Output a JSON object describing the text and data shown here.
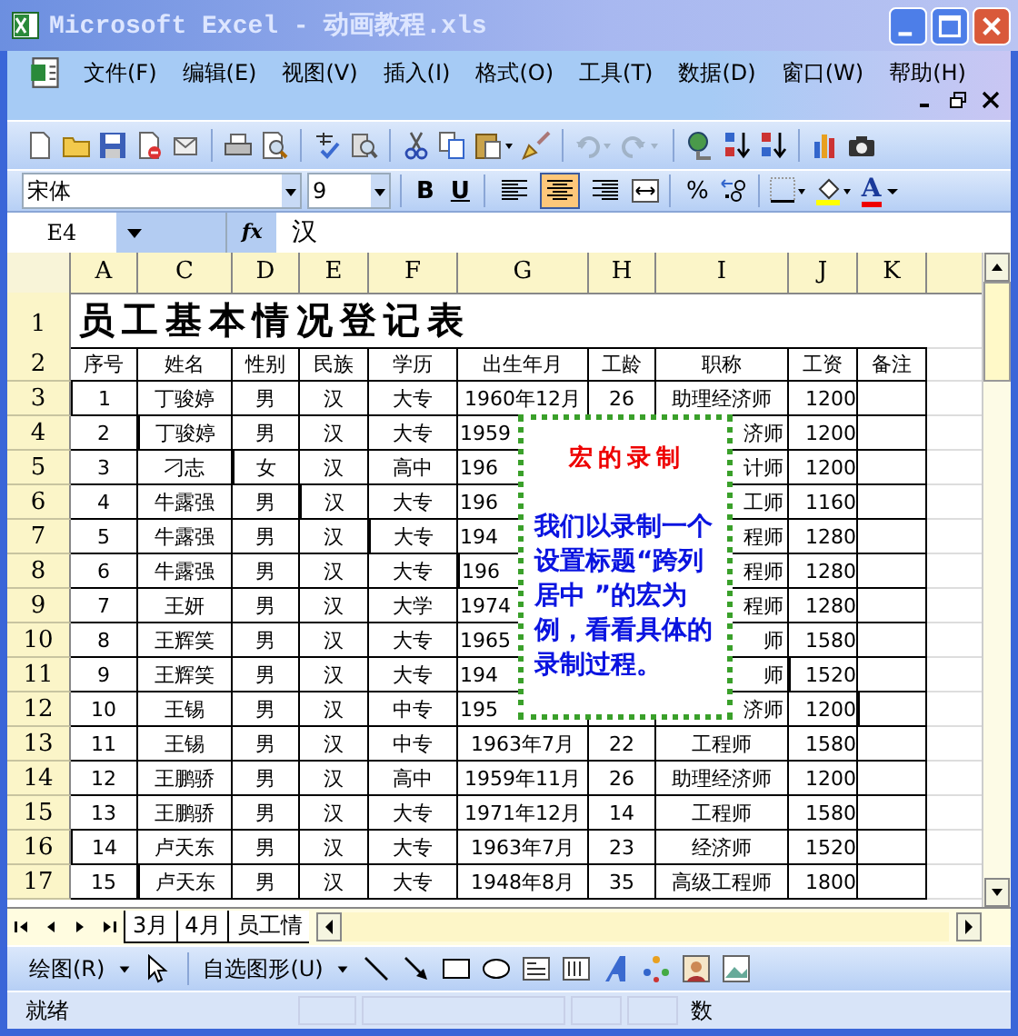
{
  "window": {
    "title": "Microsoft Excel - 动画教程.xls"
  },
  "menu": [
    "文件(F)",
    "编辑(E)",
    "视图(V)",
    "插入(I)",
    "格式(O)",
    "工具(T)",
    "数据(D)",
    "窗口(W)",
    "帮助(H)"
  ],
  "format_toolbar": {
    "font": "宋体",
    "size": "9",
    "bold": "B",
    "underline": "U",
    "percent": "%",
    "font_color": "A",
    "alignment": [
      {
        "kind": "left",
        "selected": false
      },
      {
        "kind": "center",
        "selected": true
      },
      {
        "kind": "right",
        "selected": false
      }
    ]
  },
  "formula_bar": {
    "cell": "E4",
    "fx": "fx",
    "value": "汉"
  },
  "sheet": {
    "columns": [
      "A",
      "C",
      "D",
      "E",
      "F",
      "G",
      "H",
      "I",
      "J",
      "K"
    ],
    "title_row_header": "1",
    "title": "员工基本情况登记表",
    "rows": [
      {
        "header": "2",
        "cells": [
          "序号",
          "姓名",
          "性别",
          "民族",
          "学历",
          "出生年月",
          "工龄",
          "职称",
          "工资",
          "备注"
        ]
      },
      {
        "header": "3",
        "cells": [
          "1",
          "丁骏婷",
          "男",
          "汉",
          "大专",
          "1960年12月",
          "26",
          "助理经济师",
          "1200",
          ""
        ]
      },
      {
        "header": "4",
        "partial": true,
        "cells": [
          "2",
          "丁骏婷",
          "男",
          "汉",
          "大专",
          "1959",
          "",
          "济师",
          "1200",
          ""
        ]
      },
      {
        "header": "5",
        "partial": true,
        "cells": [
          "3",
          "刁志",
          "女",
          "汉",
          "高中",
          "196",
          "",
          "计师",
          "1200",
          ""
        ]
      },
      {
        "header": "6",
        "partial": true,
        "cells": [
          "4",
          "牛露强",
          "男",
          "汉",
          "大专",
          "196",
          "",
          "工师",
          "1160",
          ""
        ]
      },
      {
        "header": "7",
        "partial": true,
        "cells": [
          "5",
          "牛露强",
          "男",
          "汉",
          "大专",
          "194",
          "",
          "程师",
          "1280",
          ""
        ]
      },
      {
        "header": "8",
        "partial": true,
        "cells": [
          "6",
          "牛露强",
          "男",
          "汉",
          "大专",
          "196",
          "",
          "程师",
          "1280",
          ""
        ]
      },
      {
        "header": "9",
        "partial": true,
        "cells": [
          "7",
          "王妍",
          "男",
          "汉",
          "大学",
          "1974",
          "",
          "程师",
          "1280",
          ""
        ]
      },
      {
        "header": "10",
        "partial": true,
        "cells": [
          "8",
          "王辉笑",
          "男",
          "汉",
          "大专",
          "1965",
          "",
          "师",
          "1580",
          ""
        ]
      },
      {
        "header": "11",
        "partial": true,
        "cells": [
          "9",
          "王辉笑",
          "男",
          "汉",
          "大专",
          "194",
          "",
          "师",
          "1520",
          ""
        ]
      },
      {
        "header": "12",
        "partial": true,
        "cells": [
          "10",
          "王锡",
          "男",
          "汉",
          "中专",
          "195",
          "",
          "济师",
          "1200",
          ""
        ]
      },
      {
        "header": "13",
        "cells": [
          "11",
          "王锡",
          "男",
          "汉",
          "中专",
          "1963年7月",
          "22",
          "工程师",
          "1580",
          ""
        ]
      },
      {
        "header": "14",
        "cells": [
          "12",
          "王鹏骄",
          "男",
          "汉",
          "高中",
          "1959年11月",
          "26",
          "助理经济师",
          "1200",
          ""
        ]
      },
      {
        "header": "15",
        "cells": [
          "13",
          "王鹏骄",
          "男",
          "汉",
          "大专",
          "1971年12月",
          "14",
          "工程师",
          "1580",
          ""
        ]
      },
      {
        "header": "16",
        "cells": [
          "14",
          "卢天东",
          "男",
          "汉",
          "大专",
          "1963年7月",
          "23",
          "经济师",
          "1520",
          ""
        ]
      },
      {
        "header": "17",
        "cells": [
          "15",
          "卢天东",
          "男",
          "汉",
          "大专",
          "1948年8月",
          "35",
          "高级工程师",
          "1800",
          ""
        ]
      }
    ]
  },
  "callout": {
    "title": "宏的录制",
    "text": "我们以录制一个设置标题“跨列居中 ”的宏为例，看看具体的录制过程。"
  },
  "sheet_tabs": [
    "3月",
    "4月",
    "员工情"
  ],
  "drawing_toolbar": {
    "draw": "绘图(R)",
    "autoshapes": "自选图形(U)"
  },
  "status_bar": {
    "text": "就绪",
    "indicator": "数"
  }
}
